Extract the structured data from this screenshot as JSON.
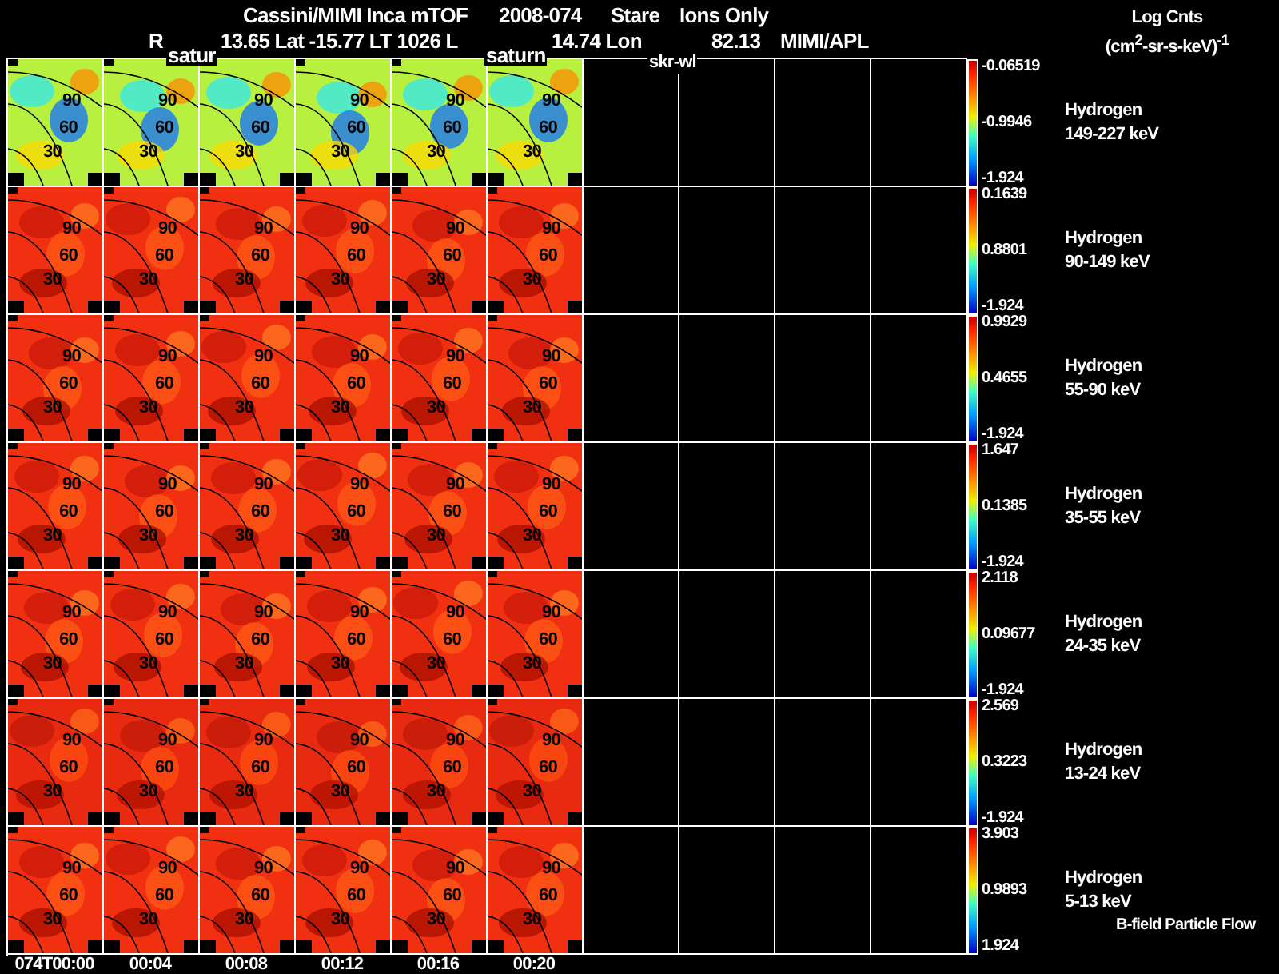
{
  "title_line": [
    "Cassini/MIMI Inca mTOF",
    "2008-074",
    "Stare",
    "Ions Only"
  ],
  "info_line": [
    "R",
    "13.65 Lat -15.77 LT 1026 L",
    "14.74 Lon",
    "82.13",
    "MIMI/APL"
  ],
  "units": {
    "label": "Log Cnts",
    "unit": "(cm$^{2}$-sr-s-keV)$^{-1}$"
  },
  "overlay_labels": [
    "satur",
    "saturn",
    "skr-wl"
  ],
  "panels": [
    {
      "species": "Hydrogen",
      "energy": "149-227 keV",
      "max": "-0.06519",
      "mid": "-0.9946",
      "min": "-1.924",
      "images": [
        {
          "contours": [
            "90",
            "60",
            "30"
          ]
        },
        {
          "contours": [
            "90",
            "60",
            "30"
          ]
        },
        {
          "contours": [
            "90",
            "60",
            "30"
          ]
        },
        {
          "contours": [
            "90",
            "60",
            "30"
          ]
        },
        {
          "contours": [
            "90",
            "60",
            "30"
          ]
        },
        {
          "contours": [
            "90",
            "60",
            "30"
          ]
        }
      ]
    },
    {
      "species": "Hydrogen",
      "energy": "90-149 keV",
      "max": "0.1639",
      "mid": "0.8801",
      "min": "-1.924",
      "images": [
        {
          "contours": [
            "90",
            "60",
            "30"
          ]
        },
        {
          "contours": [
            "90",
            "60",
            "30"
          ]
        },
        {
          "contours": [
            "90",
            "60",
            "30"
          ]
        },
        {
          "contours": [
            "90",
            "60",
            "30"
          ]
        },
        {
          "contours": [
            "90",
            "60",
            "30"
          ]
        },
        {
          "contours": [
            "90",
            "60",
            "30"
          ]
        }
      ]
    },
    {
      "species": "Hydrogen",
      "energy": "55-90 keV",
      "max": "0.9929",
      "mid": "0.4655",
      "min": "-1.924",
      "images": [
        {
          "contours": [
            "90",
            "60",
            "30"
          ]
        },
        {
          "contours": [
            "90",
            "60",
            "30"
          ]
        },
        {
          "contours": [
            "90",
            "60",
            "30"
          ]
        },
        {
          "contours": [
            "90",
            "60",
            "30"
          ]
        },
        {
          "contours": [
            "90",
            "60",
            "30"
          ]
        },
        {
          "contours": [
            "90",
            "60",
            "30"
          ]
        }
      ]
    },
    {
      "species": "Hydrogen",
      "energy": "35-55 keV",
      "max": "1.647",
      "mid": "0.1385",
      "min": "-1.924",
      "images": [
        {
          "contours": [
            "90",
            "60",
            "30"
          ]
        },
        {
          "contours": [
            "90",
            "60",
            "30"
          ]
        },
        {
          "contours": [
            "90",
            "60",
            "30"
          ]
        },
        {
          "contours": [
            "90",
            "60",
            "30"
          ]
        },
        {
          "contours": [
            "90",
            "60",
            "30"
          ]
        },
        {
          "contours": [
            "90",
            "60",
            "30"
          ]
        }
      ]
    },
    {
      "species": "Hydrogen",
      "energy": "24-35 keV",
      "max": "2.118",
      "mid": "0.09677",
      "min": "-1.924",
      "images": [
        {
          "contours": [
            "90",
            "60",
            "30"
          ]
        },
        {
          "contours": [
            "90",
            "60",
            "30"
          ]
        },
        {
          "contours": [
            "90",
            "60",
            "30"
          ]
        },
        {
          "contours": [
            "90",
            "60",
            "30"
          ]
        },
        {
          "contours": [
            "90",
            "60",
            "30"
          ]
        },
        {
          "contours": [
            "90",
            "60",
            "30"
          ]
        }
      ]
    },
    {
      "species": "Hydrogen",
      "energy": "13-24 keV",
      "max": "2.569",
      "mid": "0.3223",
      "min": "-1.924",
      "images": [
        {
          "contours": [
            "90",
            "60",
            "30"
          ]
        },
        {
          "contours": [
            "90",
            "60",
            "30"
          ]
        },
        {
          "contours": [
            "90",
            "60",
            "30"
          ]
        },
        {
          "contours": [
            "90",
            "60",
            "30"
          ]
        },
        {
          "contours": [
            "90",
            "60",
            "30"
          ]
        },
        {
          "contours": [
            "90",
            "60",
            "30"
          ]
        }
      ]
    },
    {
      "species": "Hydrogen",
      "energy": "5-13 keV",
      "max": "3.903",
      "mid": "0.9893",
      "min": "1.924",
      "images": [
        {
          "contours": [
            "90",
            "60",
            "30"
          ]
        },
        {
          "contours": [
            "90",
            "60",
            "30"
          ]
        },
        {
          "contours": [
            "90",
            "60",
            "30"
          ]
        },
        {
          "contours": [
            "90",
            "60",
            "30"
          ]
        },
        {
          "contours": [
            "90",
            "60",
            "30"
          ]
        },
        {
          "contours": [
            "90",
            "60",
            "30"
          ]
        }
      ]
    }
  ],
  "footnote": "B-field Particle Flow",
  "times": [
    "074T00:00",
    "00:04",
    "00:08",
    "00:12",
    "00:16",
    "00:20"
  ]
}
